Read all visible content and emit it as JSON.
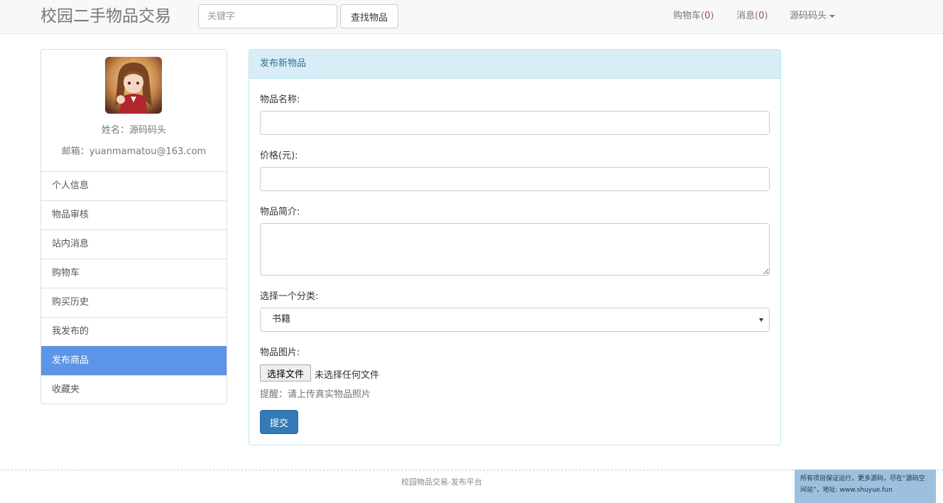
{
  "navbar": {
    "brand": "校园二手物品交易",
    "search_placeholder": "关键字",
    "search_button": "查找物品",
    "cart_label": "购物车(",
    "cart_count": "0",
    "messages_label": "消息(",
    "messages_count": "0",
    "close_paren": ")",
    "user_menu": "源码码头"
  },
  "sidebar": {
    "name": "姓名：源码码头",
    "email": "邮箱：yuanmamatou@163.com",
    "items": [
      {
        "label": "个人信息"
      },
      {
        "label": "物品审核"
      },
      {
        "label": "站内消息"
      },
      {
        "label": "购物车"
      },
      {
        "label": "购买历史"
      },
      {
        "label": "我发布的"
      },
      {
        "label": "发布商品"
      },
      {
        "label": "收藏夹"
      }
    ],
    "active_item": "发布商品"
  },
  "form": {
    "heading": "发布新物品",
    "name_label": "物品名称:",
    "name_value": "",
    "price_label": "价格(元):",
    "price_value": "",
    "desc_label": "物品简介:",
    "desc_value": "",
    "category_label": "选择一个分类:",
    "category_value": "书籍",
    "image_label": "物品图片:",
    "file_button": "选择文件",
    "file_status": "未选择任何文件",
    "hint": "提醒：请上传真实物品照片",
    "submit": "提交"
  },
  "footer": {
    "text": "校园物品交易-发布平台"
  },
  "watermark": {
    "text": "所有项目保证运行，更多源码，尽在“源码空间站”，地址: www.shuyue.fun"
  }
}
